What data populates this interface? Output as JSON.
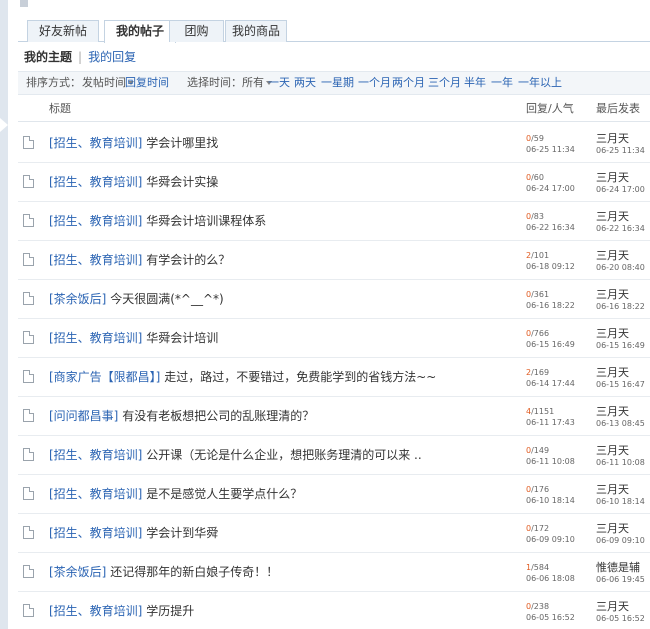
{
  "tabs": [
    {
      "label": "好友新帖"
    },
    {
      "label": "我的帖子"
    },
    {
      "label": "团购"
    },
    {
      "label": "我的商品"
    }
  ],
  "subtabs": {
    "active": "我的主题",
    "other": "我的回复"
  },
  "filter": {
    "sort_label": "排序方式：",
    "sort_selected": "发帖时间",
    "sort_other": "回复时间",
    "time_label": "选择时间：",
    "time_selected": "所有",
    "ranges": [
      "一天",
      "两天",
      "一星期",
      "一个月",
      "两个月",
      "三个月",
      "半年",
      "一年",
      "一年以上"
    ]
  },
  "table": {
    "headers": {
      "title": "标题",
      "stats": "回复/人气",
      "last": "最后发表"
    },
    "rows": [
      {
        "category": "[招生、教育培训]",
        "title": "学会计哪里找",
        "replies": "0",
        "views": "59",
        "posted": "06-25 11:34",
        "last_by": "三月天",
        "last_time": "06-25 11:34"
      },
      {
        "category": "[招生、教育培训]",
        "title": "华舜会计实操",
        "replies": "0",
        "views": "60",
        "posted": "06-24 17:00",
        "last_by": "三月天",
        "last_time": "06-24 17:00"
      },
      {
        "category": "[招生、教育培训]",
        "title": "华舜会计培训课程体系",
        "replies": "0",
        "views": "83",
        "posted": "06-22 16:34",
        "last_by": "三月天",
        "last_time": "06-22 16:34"
      },
      {
        "category": "[招生、教育培训]",
        "title": "有学会计的么？",
        "replies": "2",
        "views": "101",
        "posted": "06-18 09:12",
        "last_by": "三月天",
        "last_time": "06-20 08:40"
      },
      {
        "category": "[茶余饭后]",
        "title": "今天很圆满(*^__^*)",
        "replies": "0",
        "views": "361",
        "posted": "06-16 18:22",
        "last_by": "三月天",
        "last_time": "06-16 18:22"
      },
      {
        "category": "[招生、教育培训]",
        "title": "华舜会计培训",
        "replies": "0",
        "views": "766",
        "posted": "06-15 16:49",
        "last_by": "三月天",
        "last_time": "06-15 16:49"
      },
      {
        "category": "[商家广告【限都昌】]",
        "title": "走过，路过，不要错过，免费能学到的省钱方法~~",
        "replies": "2",
        "views": "169",
        "posted": "06-14 17:44",
        "last_by": "三月天",
        "last_time": "06-15 16:47"
      },
      {
        "category": "[问问都昌事]",
        "title": "有没有老板想把公司的乱账理清的？",
        "replies": "4",
        "views": "1151",
        "posted": "06-11 17:43",
        "last_by": "三月天",
        "last_time": "06-13 08:45"
      },
      {
        "category": "[招生、教育培训]",
        "title": "公开课（无论是什么企业，想把账务理清的可以来 ..",
        "replies": "0",
        "views": "149",
        "posted": "06-11 10:08",
        "last_by": "三月天",
        "last_time": "06-11 10:08"
      },
      {
        "category": "[招生、教育培训]",
        "title": "是不是感觉人生要学点什么？",
        "replies": "0",
        "views": "176",
        "posted": "06-10 18:14",
        "last_by": "三月天",
        "last_time": "06-10 18:14"
      },
      {
        "category": "[招生、教育培训]",
        "title": "学会计到华舜",
        "replies": "0",
        "views": "172",
        "posted": "06-09 09:10",
        "last_by": "三月天",
        "last_time": "06-09 09:10"
      },
      {
        "category": "[茶余饭后]",
        "title": "还记得那年的新白娘子传奇！！",
        "replies": "1",
        "views": "584",
        "posted": "06-06 18:08",
        "last_by": "惟德是辅",
        "last_time": "06-06 19:45"
      },
      {
        "category": "[招生、教育培训]",
        "title": "学历提升",
        "replies": "0",
        "views": "238",
        "posted": "06-05 16:52",
        "last_by": "三月天",
        "last_time": "06-05 16:52"
      }
    ]
  }
}
